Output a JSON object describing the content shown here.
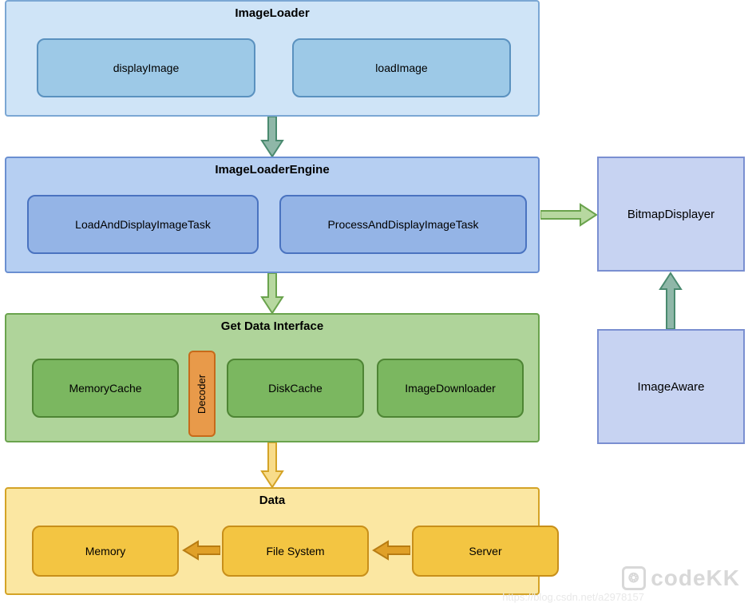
{
  "layer1": {
    "title": "ImageLoader",
    "children": [
      "displayImage",
      "loadImage"
    ]
  },
  "layer2": {
    "title": "ImageLoaderEngine",
    "children": [
      "LoadAndDisplayImageTask",
      "ProcessAndDisplayImageTask"
    ]
  },
  "layer3": {
    "title": "Get Data Interface",
    "children": [
      "MemoryCache",
      "DiskCache",
      "ImageDownloader"
    ],
    "decoder": "Decoder"
  },
  "layer4": {
    "title": "Data",
    "children": [
      "Memory",
      "File System",
      "Server"
    ]
  },
  "right": {
    "top": "BitmapDisplayer",
    "bottom": "ImageAware"
  },
  "watermark": {
    "brand": "codeKK",
    "url": "https://blog.csdn.net/a2978157"
  }
}
